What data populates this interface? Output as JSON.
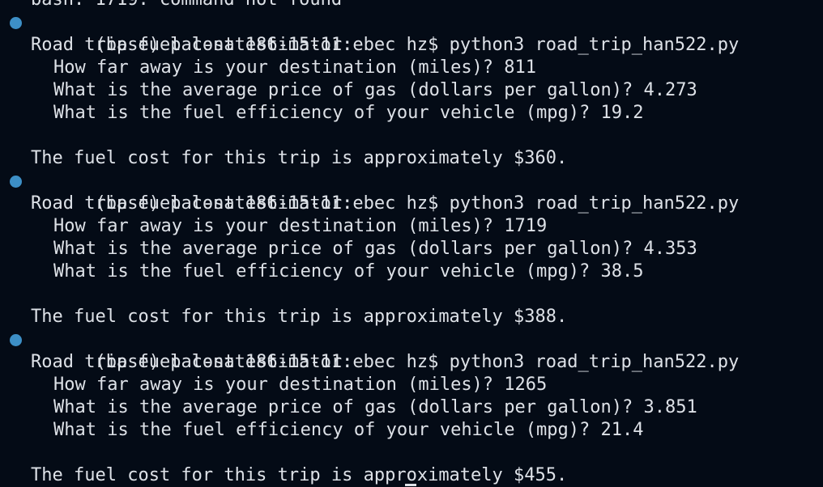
{
  "terminal": {
    "colors": {
      "background": "#040b16",
      "text": "#dde1e7",
      "prompt_bullet": "#3d8fc6"
    },
    "top_line": "bash: 1719: command not found",
    "runs": [
      {
        "prompt": "(base) pal-nat186-15-11:ebec hz$ python3 road_trip_han522.py",
        "heading": "Road trip fuel cost estimator:",
        "q_distance": "How far away is your destination (miles)? 811",
        "q_price": "What is the average price of gas (dollars per gallon)? 4.273",
        "q_efficiency": "What is the fuel efficiency of your vehicle (mpg)? 19.2",
        "result": "The fuel cost for this trip is approximately $360."
      },
      {
        "prompt": "(base) pal-nat186-15-11:ebec hz$ python3 road_trip_han522.py",
        "heading": "Road trip fuel cost estimator:",
        "q_distance": "How far away is your destination (miles)? 1719",
        "q_price": "What is the average price of gas (dollars per gallon)? 4.353",
        "q_efficiency": "What is the fuel efficiency of your vehicle (mpg)? 38.5",
        "result": "The fuel cost for this trip is approximately $388."
      },
      {
        "prompt": "(base) pal-nat186-15-11:ebec hz$ python3 road_trip_han522.py",
        "heading": "Road trip fuel cost estimator:",
        "q_distance": "How far away is your destination (miles)? 1265",
        "q_price": "What is the average price of gas (dollars per gallon)? 3.851",
        "q_efficiency": "What is the fuel efficiency of your vehicle (mpg)? 21.4",
        "result": "The fuel cost for this trip is approximately $455."
      }
    ]
  }
}
